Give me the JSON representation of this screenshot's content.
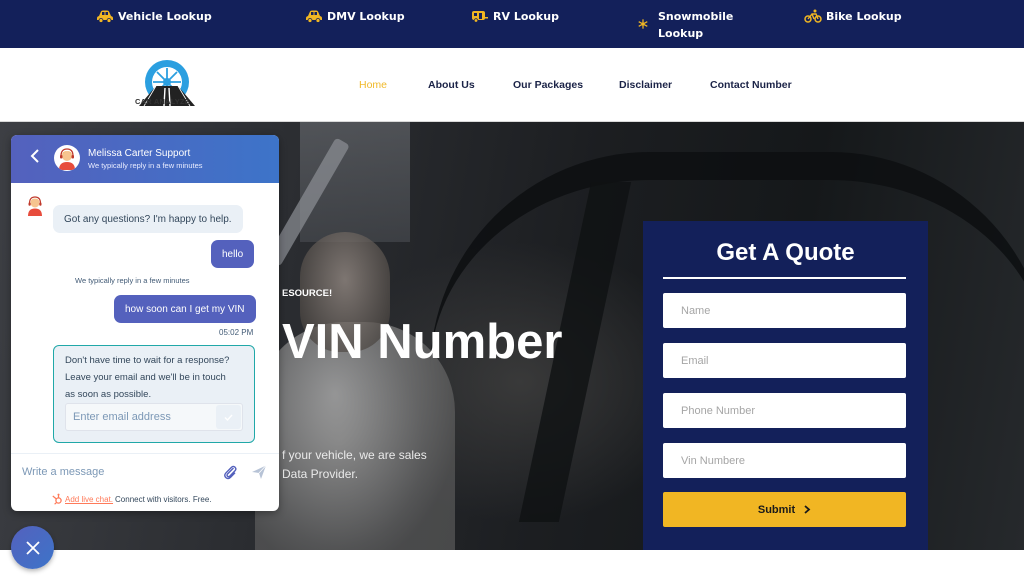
{
  "topbar": {
    "items": [
      {
        "icon": "car-icon",
        "label": "Vehicle Lookup"
      },
      {
        "icon": "car-icon",
        "label": "DMV Lookup"
      },
      {
        "icon": "rv-icon",
        "label": "RV Lookup"
      },
      {
        "icon": "snowflake-icon",
        "label": "Snowmobile\nLookup"
      },
      {
        "icon": "bicycle-icon",
        "label": "Bike Lookup"
      }
    ],
    "icon_color": "#f1b623",
    "background": "#13205a"
  },
  "header": {
    "logo_text": "CAR ANALYZE",
    "nav": [
      {
        "label": "Home",
        "active": true
      },
      {
        "label": "About Us",
        "active": false
      },
      {
        "label": "Our Packages",
        "active": false
      },
      {
        "label": "Disclaimer",
        "active": false
      },
      {
        "label": "Contact Number",
        "active": false
      }
    ],
    "active_color": "#f0b92a"
  },
  "hero": {
    "eyebrow": "ESOURCE!",
    "title": "VIN Number",
    "description": "f your vehicle, we are sales\n Data Provider."
  },
  "quote_form": {
    "title": "Get A Quote",
    "fields": [
      {
        "name": "name",
        "placeholder": "Name",
        "value": ""
      },
      {
        "name": "email",
        "placeholder": "Email",
        "value": ""
      },
      {
        "name": "phone",
        "placeholder": "Phone Number",
        "value": ""
      },
      {
        "name": "vin",
        "placeholder": "Vin Numbere",
        "value": ""
      }
    ],
    "submit_label": "Submit",
    "submit_icon": "chevron-right-icon",
    "background": "#13205a",
    "button_color": "#f1b623"
  },
  "chat": {
    "agent_name": "Melissa Carter Support",
    "agent_status": "We typically reply in a few minutes",
    "messages": [
      {
        "from": "bot",
        "text": "Got any questions? I'm happy to help."
      },
      {
        "from": "user",
        "text": "hello"
      },
      {
        "from": "note",
        "text": "We typically reply in a few minutes"
      },
      {
        "from": "user",
        "text": "how soon can I get my VIN"
      }
    ],
    "last_timestamp": "05:02 PM",
    "email_prompt": "Don't have time to wait for a response?\nLeave your email and we'll be in touch\nas soon as possible.",
    "email_placeholder": "Enter email address",
    "email_value": "",
    "input_placeholder": "Write a message",
    "input_value": "",
    "powered_link": "Add live chat.",
    "powered_text": "Connect with visitors. Free.",
    "accent": "#5461bd",
    "email_border": "#20a8a8"
  }
}
